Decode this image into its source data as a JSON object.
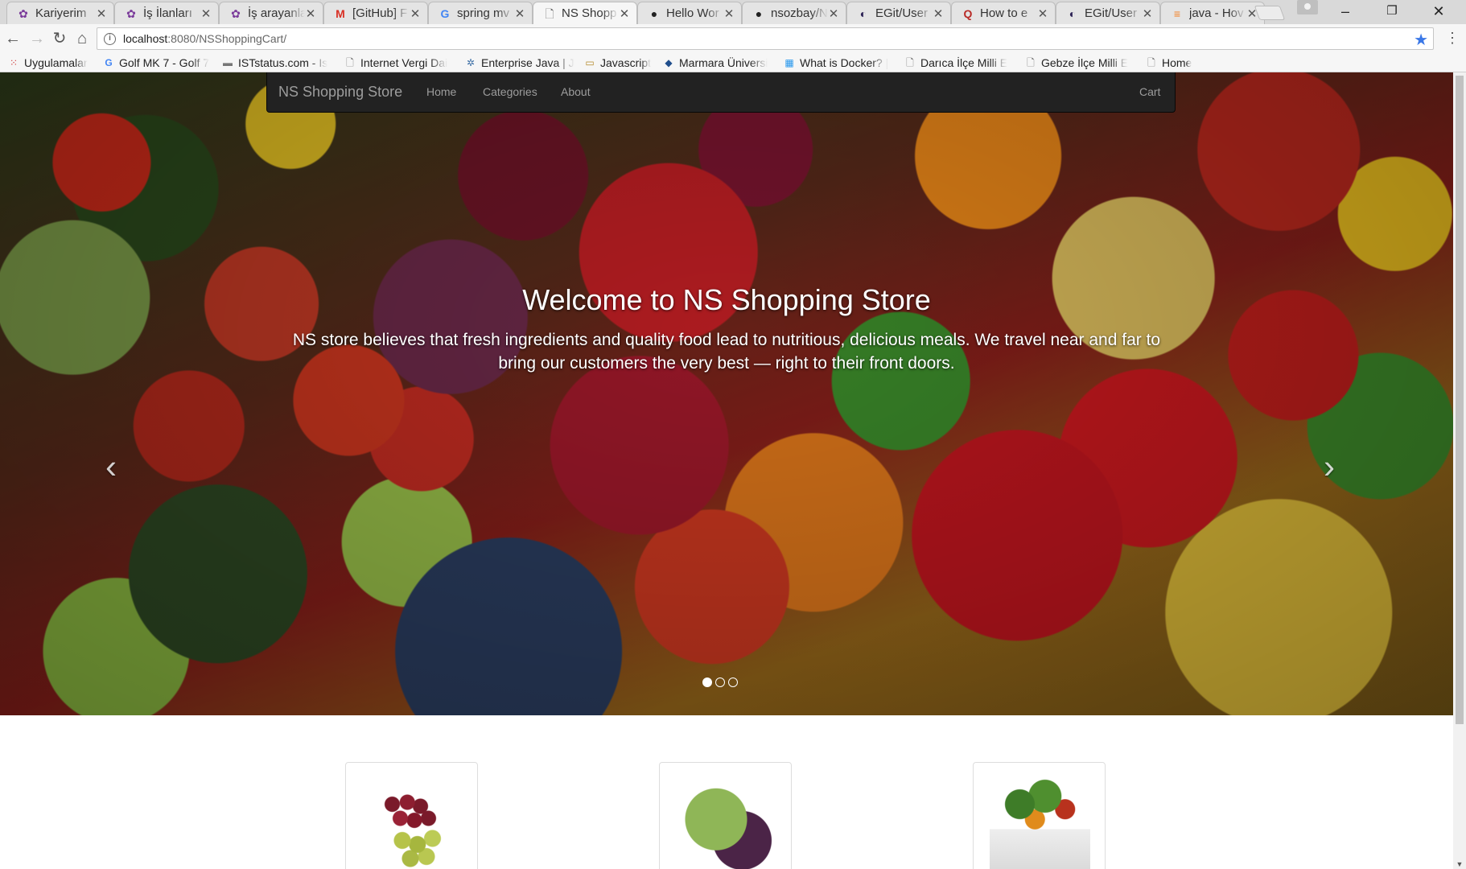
{
  "browser": {
    "tabs": [
      {
        "title": "Kariyerim",
        "icon": "kariyer-icon",
        "active": false
      },
      {
        "title": "İş İlanları",
        "icon": "kariyer-icon",
        "active": false
      },
      {
        "title": "İş arayanlar",
        "icon": "kariyer-icon",
        "active": false
      },
      {
        "title": "[GitHub] F",
        "icon": "gmail-icon",
        "active": false
      },
      {
        "title": "spring mv",
        "icon": "google-icon",
        "active": false
      },
      {
        "title": "NS Shopp",
        "icon": "page-icon",
        "active": true
      },
      {
        "title": "Hello Wor",
        "icon": "github-icon",
        "active": false
      },
      {
        "title": "nsozbay/N",
        "icon": "github-icon",
        "active": false
      },
      {
        "title": "EGit/User",
        "icon": "eclipse-icon",
        "active": false
      },
      {
        "title": "How to e",
        "icon": "quora-icon",
        "active": false
      },
      {
        "title": "EGit/User",
        "icon": "eclipse-icon",
        "active": false
      },
      {
        "title": "java - Hov",
        "icon": "stackoverflow-icon",
        "active": false
      }
    ],
    "window_controls": {
      "minimize": "–",
      "restore": "❐",
      "close": "✕"
    },
    "url": {
      "host": "localhost",
      "path": ":8080/NSShoppingCart/"
    },
    "bookmarks": [
      {
        "label": "Uygulamalar",
        "icon": "apps-grid-icon"
      },
      {
        "label": "Golf MK 7 - Golf 7",
        "icon": "google-icon"
      },
      {
        "label": "ISTstatus.com - Is",
        "icon": "ist-icon"
      },
      {
        "label": "Internet Vergi Dai",
        "icon": "page-icon"
      },
      {
        "label": "Enterprise Java | J",
        "icon": "java-icon"
      },
      {
        "label": "Javascript",
        "icon": "folder-icon"
      },
      {
        "label": "Marmara Üniversi",
        "icon": "marmara-icon"
      },
      {
        "label": "What is Docker? |",
        "icon": "docker-icon"
      },
      {
        "label": "Darıca İlçe Milli E",
        "icon": "page-icon"
      },
      {
        "label": "Gebze İlçe Milli E",
        "icon": "page-icon"
      },
      {
        "label": "Home",
        "icon": "page-icon"
      }
    ]
  },
  "navbar": {
    "brand": "NS Shopping Store",
    "links": [
      "Home",
      "Categories",
      "About"
    ],
    "cart": "Cart"
  },
  "carousel": {
    "heading": "Welcome to NS Shopping Store",
    "text_line1": "NS store believes that fresh ingredients and quality food lead to nutritious, delicious meals. We travel near and far to",
    "text_line2": "bring our customers the very best — right to their front doors.",
    "prev": "‹",
    "next": "›",
    "indicator_count": 3,
    "active_indicator": 0
  },
  "categories": [
    {
      "image": "grapes"
    },
    {
      "image": "cabbage"
    },
    {
      "image": "vegetable-basket"
    }
  ],
  "colors": {
    "navbar_bg": "#222222",
    "navbar_text": "#9d9d9d"
  }
}
